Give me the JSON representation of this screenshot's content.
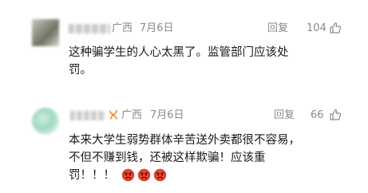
{
  "comments": [
    {
      "region": "广西",
      "date": "7月6日",
      "reply_label": "回复",
      "likes": "104",
      "text_line1": "这种骗学生的人心太黑了。监管部门应该处",
      "text_line2": "罚。"
    },
    {
      "region": "广西",
      "date": "7月6日",
      "reply_label": "回复",
      "likes": "66",
      "text_line1": "本来大学生弱势群体辛苦送外卖都很不容易，",
      "text_line2": "不但不赚到钱，还被这样欺骗！应该重",
      "text_line3": "罚！！！"
    }
  ],
  "colors": {
    "meta_gray": "#8a8a8a",
    "text": "#1a1a1a",
    "vip_orange": "#f08a24",
    "emoji_red": "#e0442a"
  },
  "icons": [
    "thumbs-up-icon",
    "vip-badge-icon",
    "angry-face-icon"
  ]
}
